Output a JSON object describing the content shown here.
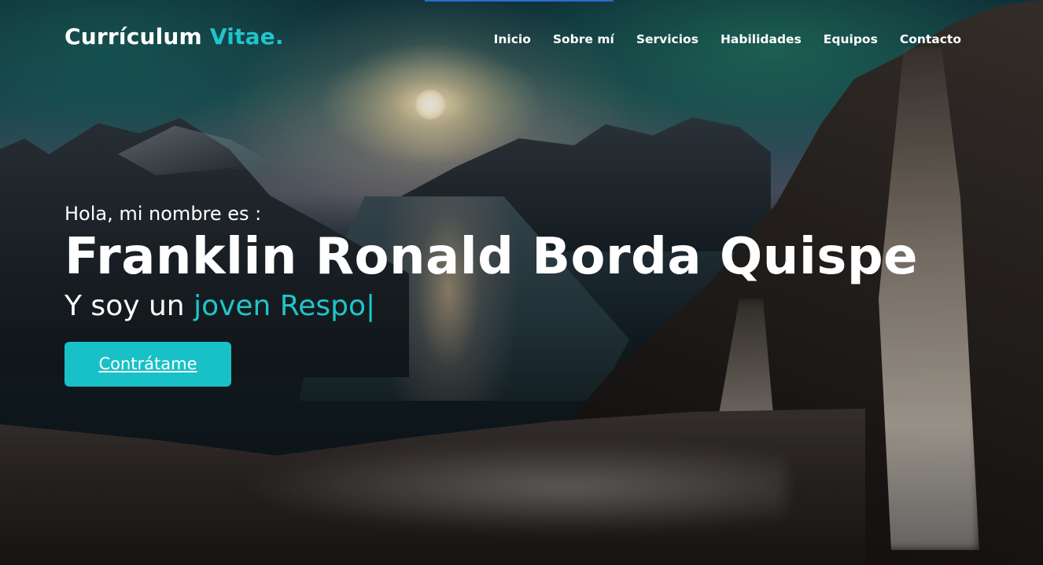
{
  "brand": {
    "main": "Currículum",
    "accent": "Vitae."
  },
  "nav": {
    "items": [
      {
        "label": "Inicio"
      },
      {
        "label": "Sobre mí"
      },
      {
        "label": "Servicios"
      },
      {
        "label": "Habilidades"
      },
      {
        "label": "Equipos"
      },
      {
        "label": "Contacto"
      }
    ]
  },
  "hero": {
    "greeting": "Hola, mi nombre es :",
    "name": "Franklin Ronald Borda Quispe",
    "tagline_prefix": "Y soy un",
    "typed_text": "joven Respo",
    "cursor": "|",
    "cta_label": "Contrátame"
  },
  "colors": {
    "accent": "#1fc5cb",
    "button": "#18c1c8",
    "text": "#ffffff"
  }
}
